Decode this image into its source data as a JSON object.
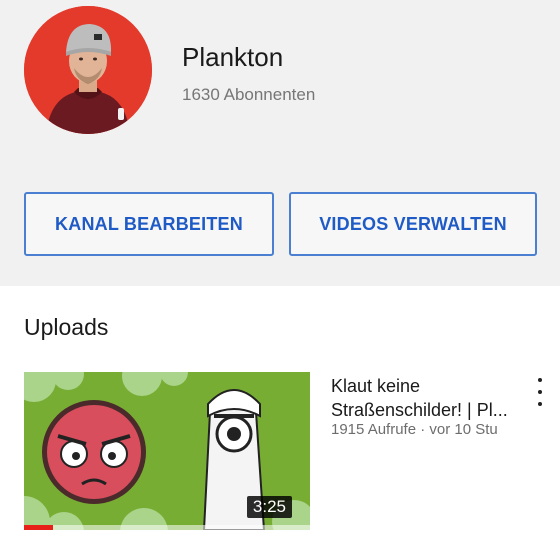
{
  "channel": {
    "name": "Plankton",
    "subscribers": "1630 Abonnenten"
  },
  "actions": {
    "edit_channel": "KANAL BEARBEITEN",
    "manage_videos": "VIDEOS VERWALTEN"
  },
  "uploads": {
    "section_title": "Uploads",
    "videos": [
      {
        "title_line1": "Klaut keine",
        "title_line2": "Straßenschilder! | Pl...",
        "meta": "1915 Aufrufe · vor 10 Stu",
        "duration": "3:25",
        "watched_fraction": 0.1
      }
    ]
  },
  "colors": {
    "header_bg": "#f1f1f1",
    "avatar_bg": "#e33a2c",
    "button_text": "#1f5bc6",
    "button_border": "#4a7fd1",
    "progress": "#e62117"
  },
  "icons": {
    "more": "more-vert-icon"
  }
}
